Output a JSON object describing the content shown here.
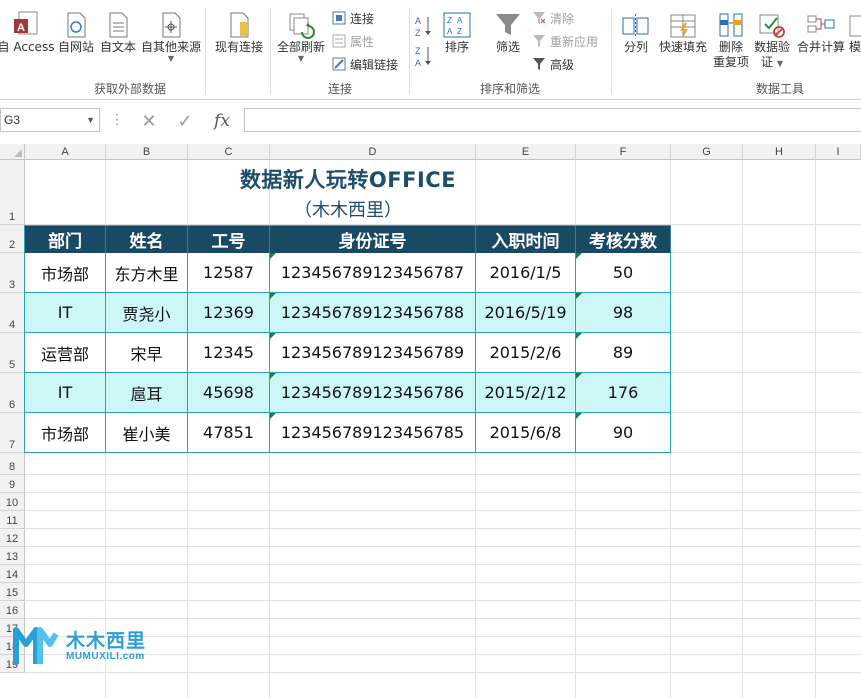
{
  "ribbon": {
    "get_external": {
      "access": "自 Access",
      "web": "自网站",
      "text": "自文本",
      "other": "自其他来源",
      "existing": "现有连接",
      "group_label": "获取外部数据"
    },
    "connections": {
      "refresh_all": "全部刷新",
      "connections": "连接",
      "properties": "属性",
      "edit_links": "编辑链接",
      "group_label": "连接"
    },
    "sort_filter": {
      "sort_az": "A↓Z",
      "sort_za": "Z↓A",
      "sort": "排序",
      "filter": "筛选",
      "clear": "清除",
      "reapply": "重新应用",
      "advanced": "高级",
      "group_label": "排序和筛选"
    },
    "data_tools": {
      "text_to_columns": "分列",
      "flash_fill": "快速填充",
      "remove_dup_1": "删除",
      "remove_dup_2": "重复项",
      "validation_1": "数据验",
      "validation_2": "证",
      "consolidate": "合并计算",
      "model": "模",
      "group_label": "数据工具"
    }
  },
  "formula_bar": {
    "name_box": "G3",
    "fx": "fx",
    "value": ""
  },
  "columns": [
    "A",
    "B",
    "C",
    "D",
    "E",
    "F",
    "G",
    "H",
    "I"
  ],
  "rows": [
    "1",
    "2",
    "3",
    "4",
    "5",
    "6",
    "7",
    "8",
    "9",
    "10",
    "11",
    "12",
    "13",
    "14",
    "15",
    "16",
    "17",
    "18",
    "19"
  ],
  "sheet": {
    "title": "数据新人玩转OFFICE",
    "subtitle": "（木木西里）",
    "headers": [
      "部门",
      "姓名",
      "工号",
      "身份证号",
      "入职时间",
      "考核分数"
    ],
    "records": [
      [
        "市场部",
        "东方木里",
        "12587",
        "123456789123456787",
        "2016/1/5",
        "50"
      ],
      [
        "IT",
        "贾尧小",
        "12369",
        "123456789123456788",
        "2016/5/19",
        "98"
      ],
      [
        "运营部",
        "宋早",
        "12345",
        "123456789123456789",
        "2015/2/6",
        "89"
      ],
      [
        "IT",
        "扈耳",
        "45698",
        "123456789123456786",
        "2015/2/12",
        "176"
      ],
      [
        "市场部",
        "崔小美",
        "47851",
        "123456789123456785",
        "2015/6/8",
        "90"
      ]
    ]
  },
  "watermark": {
    "name_cn": "木木西里",
    "name_en": "MUMUXILI.com"
  },
  "colors": {
    "header_fill": "#1a4a63",
    "alt_row_fill": "#cdf7f7",
    "border": "#2aa3b3",
    "title_color": "#1f4e6b",
    "brand_blue": "#2a9fd6"
  }
}
